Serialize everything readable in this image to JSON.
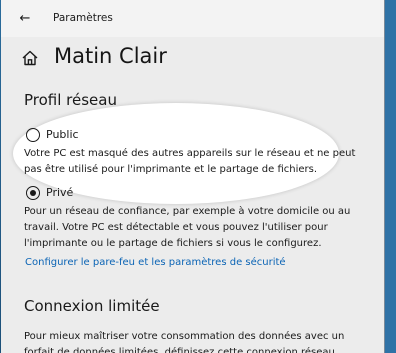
{
  "window": {
    "title": "Paramètres",
    "back_icon": "arrow-left-icon",
    "back_glyph": "←"
  },
  "page": {
    "title": "Matin Clair",
    "home_icon": "home-icon"
  },
  "network_profile": {
    "heading": "Profil réseau",
    "options": [
      {
        "label": "Public",
        "selected": false,
        "description": [
          "Votre PC est masqué des autres appareils sur le réseau et ne peut",
          "pas être utilisé pour l'imprimante et le partage de fichiers."
        ]
      },
      {
        "label": "Privé",
        "selected": true,
        "description": [
          "Pour un réseau de confiance, par exemple à votre domicile ou au",
          "travail. Votre PC est détectable et vous pouvez l'utiliser pour",
          "l'imprimante ou le partage de fichiers si vous le configurez."
        ]
      }
    ],
    "firewall_link": "Configurer le pare-feu et les paramètres de sécurité"
  },
  "metered": {
    "heading": "Connexion limitée",
    "description": [
      "Pour mieux maîtriser votre consommation des données avec un",
      "forfait de données limitées, définissez cette connexion réseau"
    ]
  },
  "colors": {
    "link": "#0b64b5",
    "window_bg": "#ececec",
    "titlebar_bg": "#f3f3f3",
    "desktop_edge": "#2f72a6"
  }
}
